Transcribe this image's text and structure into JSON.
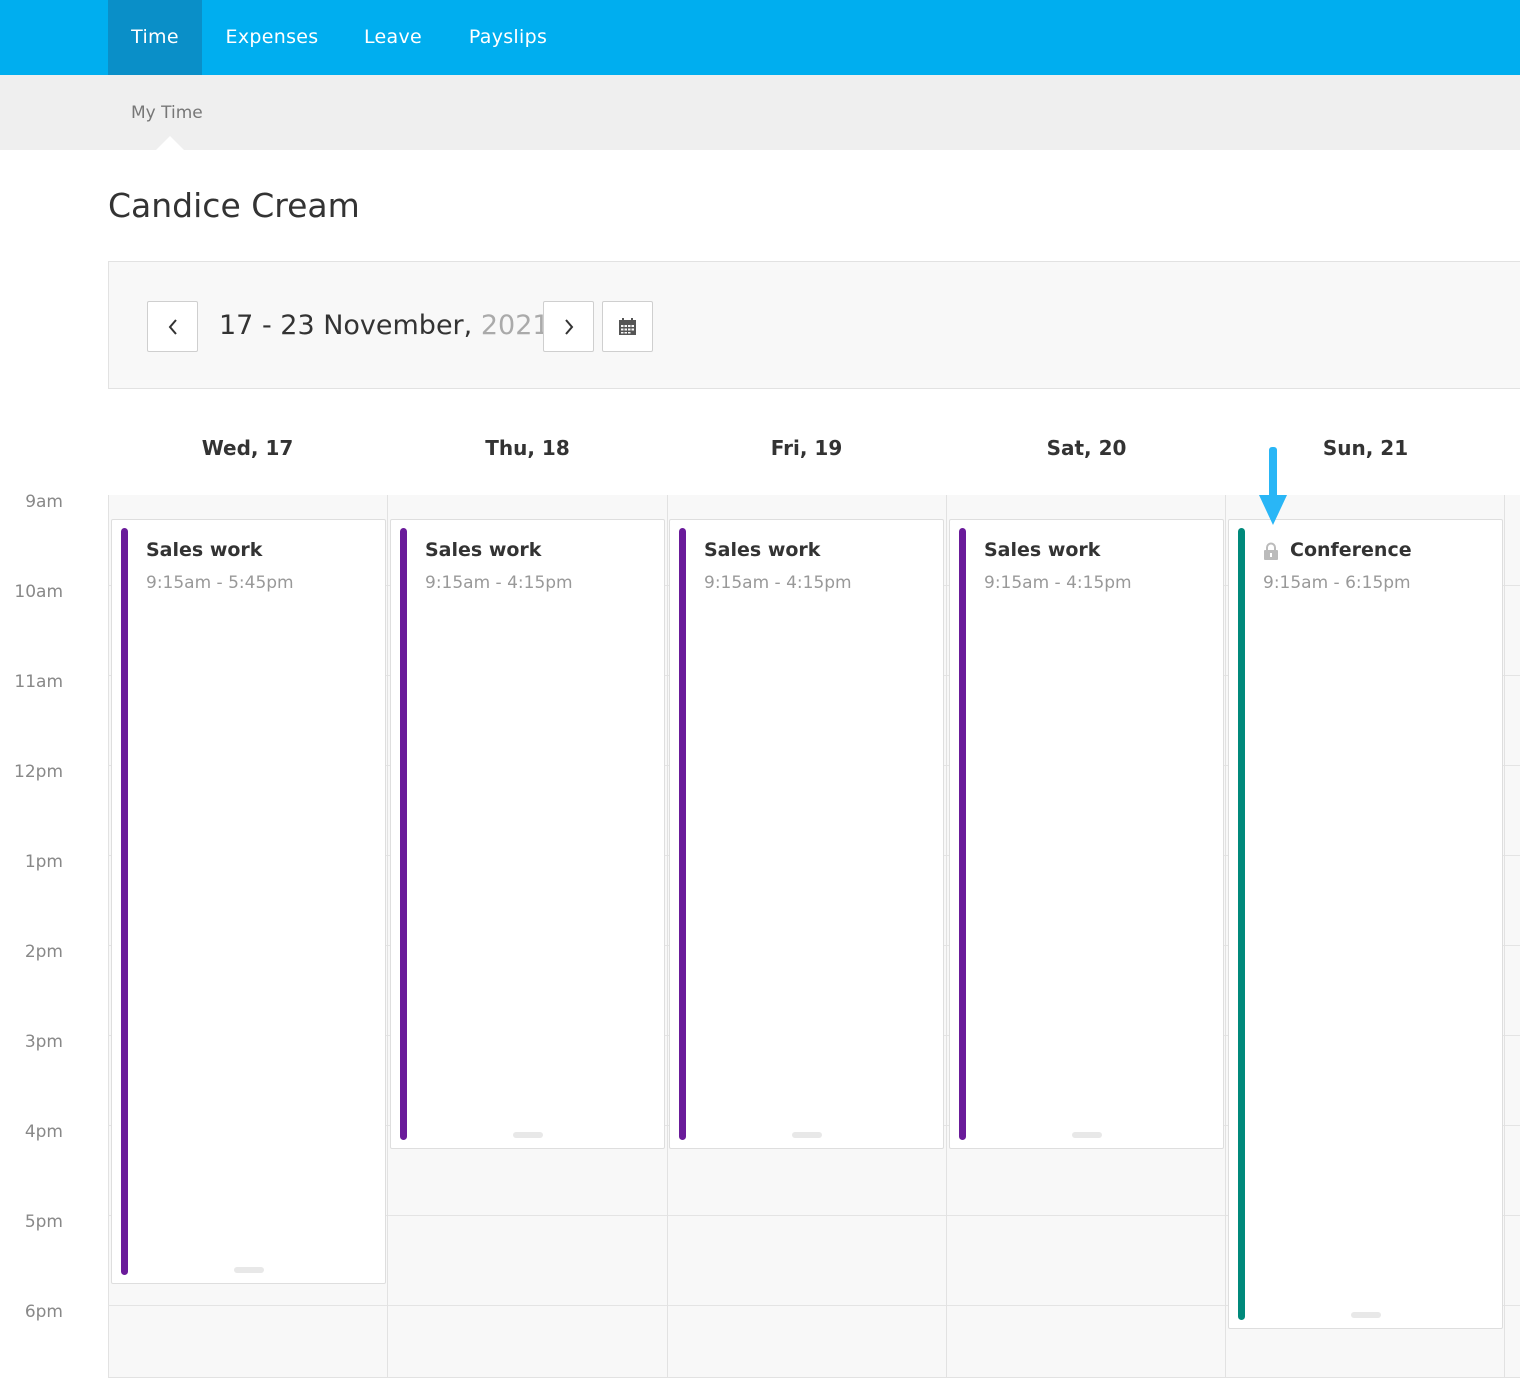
{
  "nav": {
    "tabs": [
      {
        "label": "Time",
        "active": true
      },
      {
        "label": "Expenses"
      },
      {
        "label": "Leave"
      },
      {
        "label": "Payslips"
      }
    ]
  },
  "subnav": {
    "label": "My Time"
  },
  "page": {
    "title": "Candice Cream"
  },
  "week": {
    "range": "17 - 23 November,",
    "year": "2021"
  },
  "days": [
    {
      "label": "Wed, 17"
    },
    {
      "label": "Thu, 18"
    },
    {
      "label": "Fri, 19"
    },
    {
      "label": "Sat, 20"
    },
    {
      "label": "Sun, 21"
    }
  ],
  "hours": [
    "9am",
    "10am",
    "11am",
    "12pm",
    "1pm",
    "2pm",
    "3pm",
    "4pm",
    "5pm",
    "6pm"
  ],
  "events": [
    {
      "title": "Sales work",
      "time": "9:15am - 5:45pm",
      "color": "#6a1b9a",
      "locked": false
    },
    {
      "title": "Sales work",
      "time": "9:15am - 4:15pm",
      "color": "#6a1b9a",
      "locked": false
    },
    {
      "title": "Sales work",
      "time": "9:15am - 4:15pm",
      "color": "#6a1b9a",
      "locked": false
    },
    {
      "title": "Sales work",
      "time": "9:15am - 4:15pm",
      "color": "#6a1b9a",
      "locked": false
    },
    {
      "title": "Conference",
      "time": "9:15am - 6:15pm",
      "color": "#00897b",
      "locked": true
    }
  ],
  "colors": {
    "nav": "#00aeef",
    "nav_active": "#0a8fc8",
    "annotation_arrow": "#29b6f6"
  }
}
